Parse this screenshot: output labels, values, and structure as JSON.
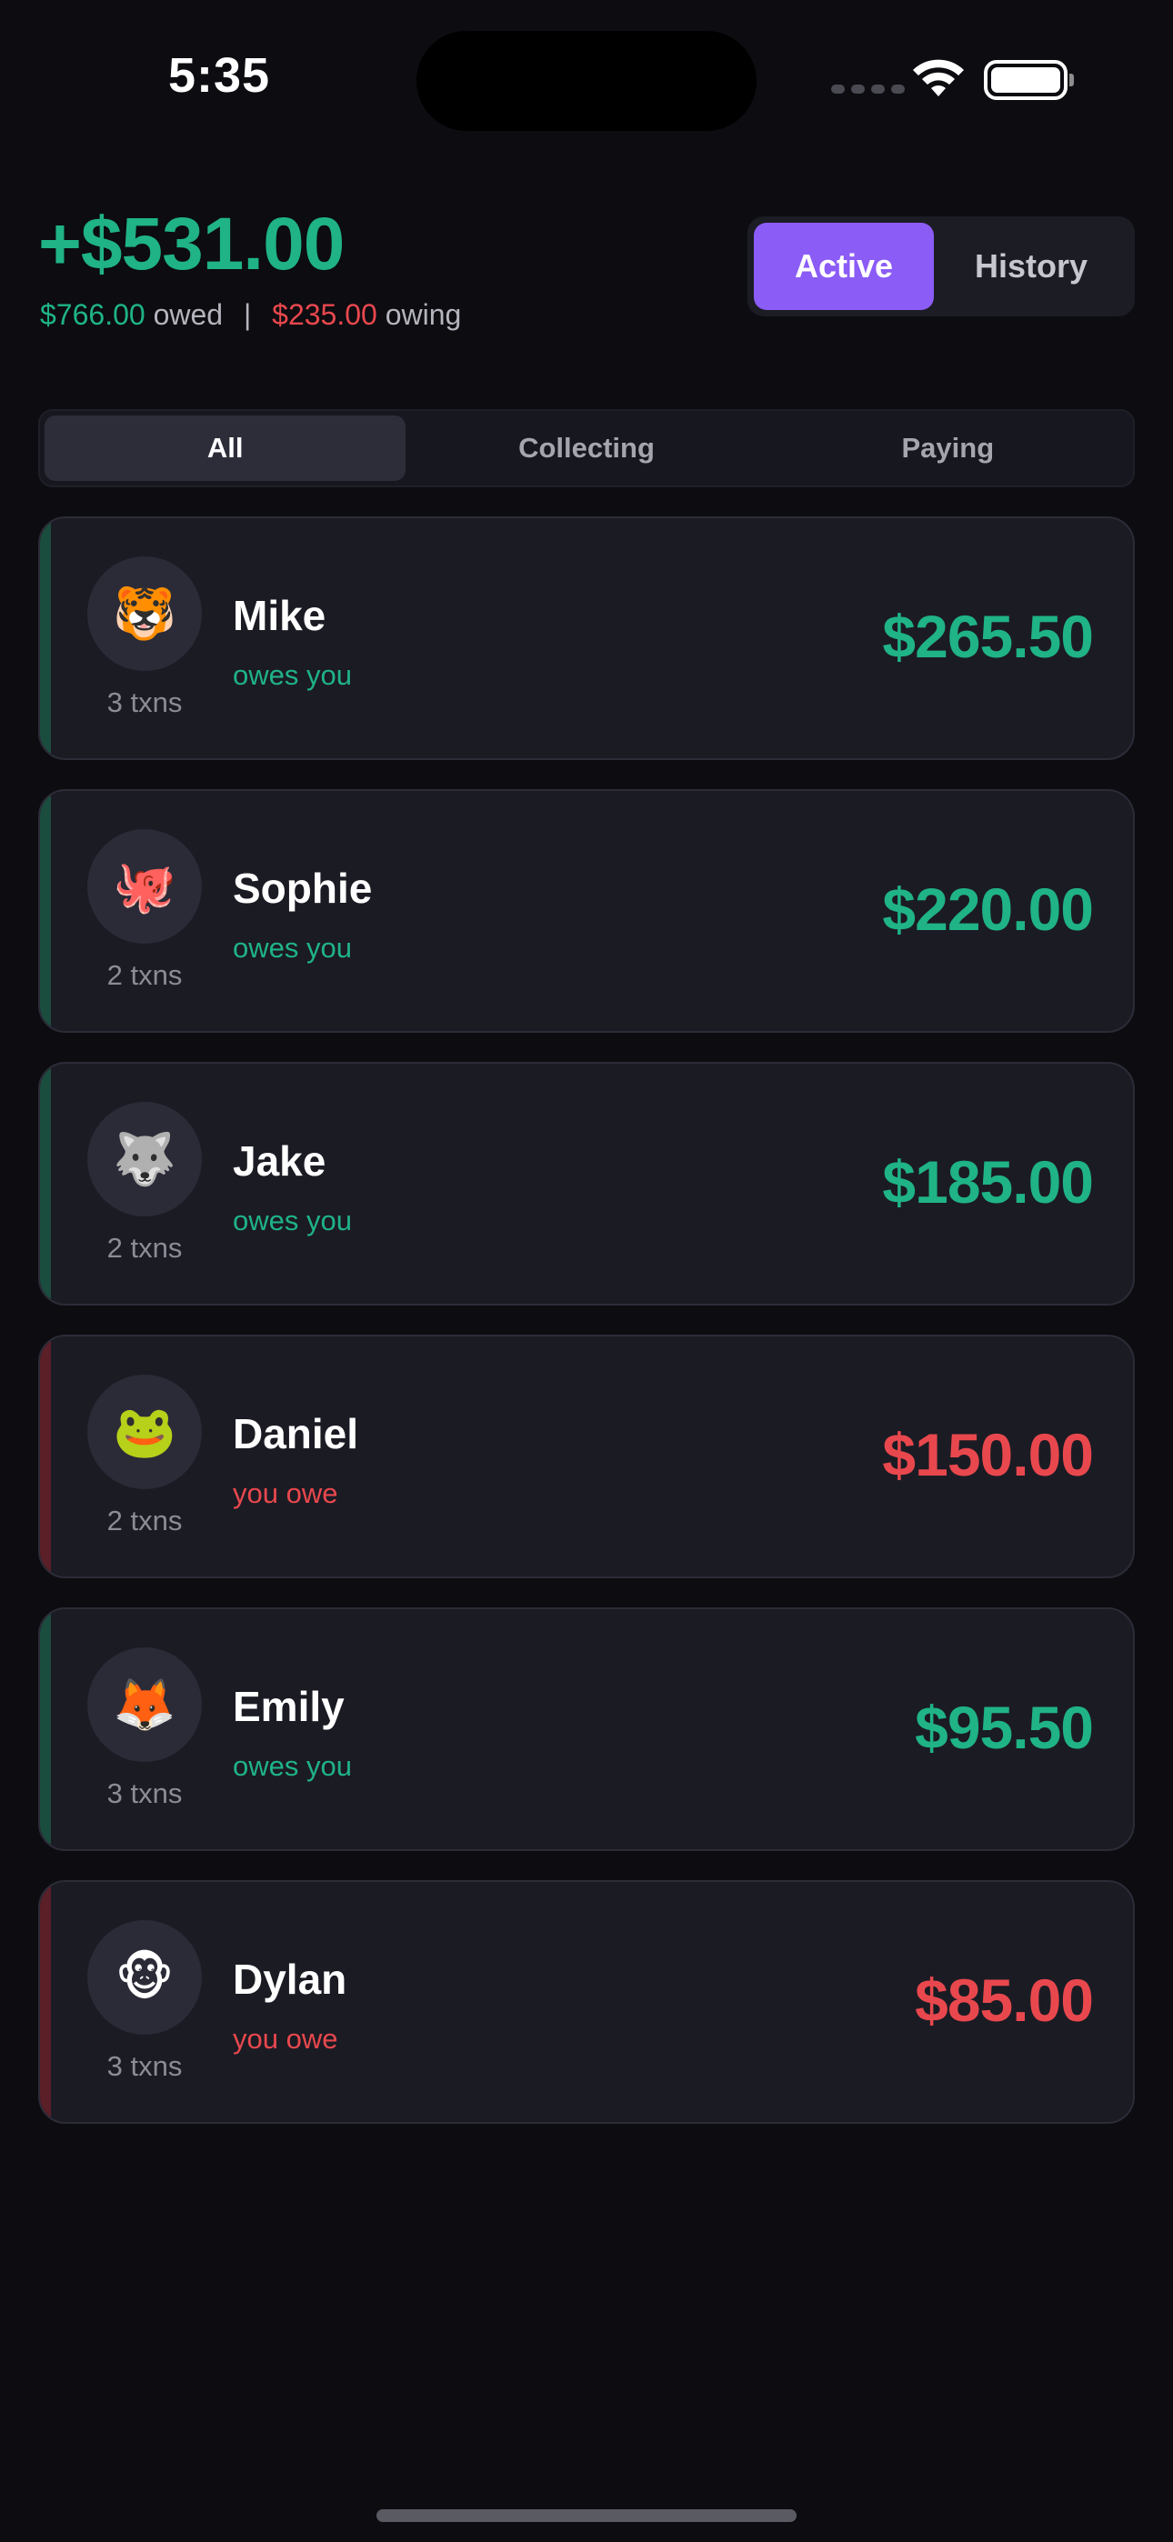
{
  "status_bar": {
    "time": "5:35"
  },
  "summary": {
    "net_balance": "+$531.00",
    "owed_amount": "$766.00",
    "owed_label": "owed",
    "separator": "|",
    "owing_amount": "$235.00",
    "owing_label": "owing"
  },
  "view_toggle": {
    "active_label": "Active",
    "history_label": "History",
    "selected": "Active"
  },
  "filters": {
    "tabs": [
      "All",
      "Collecting",
      "Paying"
    ],
    "selected": "All"
  },
  "people": [
    {
      "avatar": "🐯",
      "avatar_icon": "tiger-face-icon",
      "name": "Mike",
      "relation": "owes you",
      "txns": "3 txns",
      "amount": "$265.50",
      "direction": "pos"
    },
    {
      "avatar": "🐙",
      "avatar_icon": "octopus-icon",
      "name": "Sophie",
      "relation": "owes you",
      "txns": "2 txns",
      "amount": "$220.00",
      "direction": "pos"
    },
    {
      "avatar": "🐺",
      "avatar_icon": "wolf-face-icon",
      "name": "Jake",
      "relation": "owes you",
      "txns": "2 txns",
      "amount": "$185.00",
      "direction": "pos"
    },
    {
      "avatar": "🐸",
      "avatar_icon": "frog-face-icon",
      "name": "Daniel",
      "relation": "you owe",
      "txns": "2 txns",
      "amount": "$150.00",
      "direction": "neg"
    },
    {
      "avatar": "🦊",
      "avatar_icon": "fox-face-icon",
      "name": "Emily",
      "relation": "owes you",
      "txns": "3 txns",
      "amount": "$95.50",
      "direction": "pos"
    },
    {
      "avatar": "🐵",
      "avatar_icon": "monkey-face-icon",
      "name": "Dylan",
      "relation": "you owe",
      "txns": "3 txns",
      "amount": "$85.00",
      "direction": "neg"
    }
  ],
  "colors": {
    "background": "#0c0c11",
    "positive": "#1fb386",
    "negative": "#e8484d",
    "accent": "#8b5cf6",
    "card": "#1b1b24"
  }
}
